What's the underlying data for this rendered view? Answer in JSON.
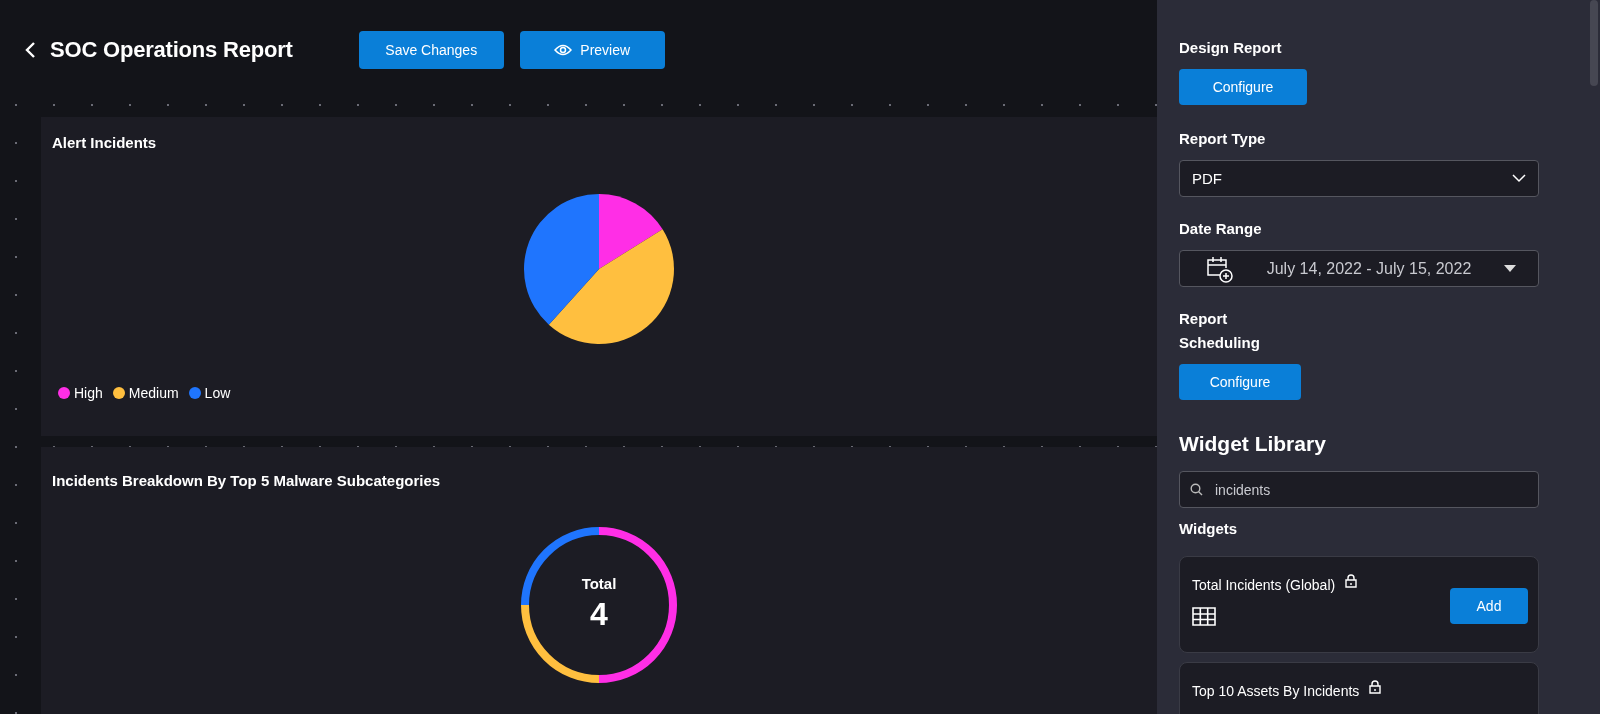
{
  "header": {
    "title": "SOC Operations Report",
    "buttons": [
      {
        "label": "Save Changes",
        "kind": "plain"
      },
      {
        "label": "Preview",
        "kind": "preview"
      }
    ]
  },
  "widgets": [
    {
      "title": "Alert Incidents",
      "kind": "pie",
      "legend": [
        {
          "label": "High",
          "color": "#ff2ee6"
        },
        {
          "label": "Medium",
          "color": "#ffbf3f"
        },
        {
          "label": "Low",
          "color": "#1f75fe"
        }
      ]
    },
    {
      "title": "Incidents Breakdown By Top 5 Malware Subcategories",
      "kind": "donut",
      "center_label": "Total",
      "center_value": "4"
    }
  ],
  "panel": {
    "design_report": {
      "label": "Design Report",
      "button": "Configure"
    },
    "report_type": {
      "label": "Report Type",
      "value": "PDF"
    },
    "date_range": {
      "label": "Date Range",
      "value": "July 14, 2022 - July 15, 2022"
    },
    "report_scheduling": {
      "label": "Report Scheduling",
      "button": "Configure"
    },
    "widget_library": {
      "title": "Widget Library",
      "search_value": "incidents",
      "widgets_label": "Widgets",
      "items": [
        {
          "title": "Total Incidents (Global)",
          "locked": true,
          "kind": "table",
          "button": "Add"
        },
        {
          "title": "Top 10 Assets By Incidents",
          "locked": true,
          "kind": "none"
        }
      ]
    }
  }
}
